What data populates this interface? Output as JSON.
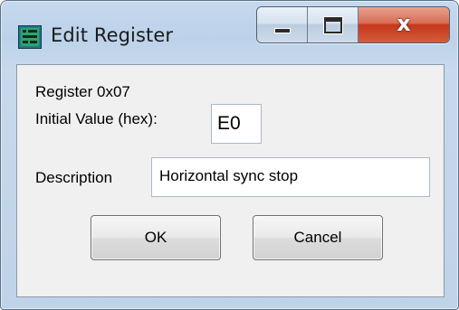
{
  "window": {
    "title": "Edit Register",
    "icon": "register-app-icon",
    "controls": {
      "minimize": "minimize-icon",
      "maximize": "maximize-icon",
      "close": "close-icon"
    }
  },
  "register": {
    "label": "Register 0x07",
    "initial_value_label": "Initial Value (hex):",
    "initial_value": "E0",
    "description_label": "Description",
    "description": "Horizontal sync stop"
  },
  "buttons": {
    "ok": "OK",
    "cancel": "Cancel"
  },
  "colors": {
    "frame": "#bfd3e8",
    "close_button": "#c5371b",
    "client_background": "#f0f0f0"
  }
}
